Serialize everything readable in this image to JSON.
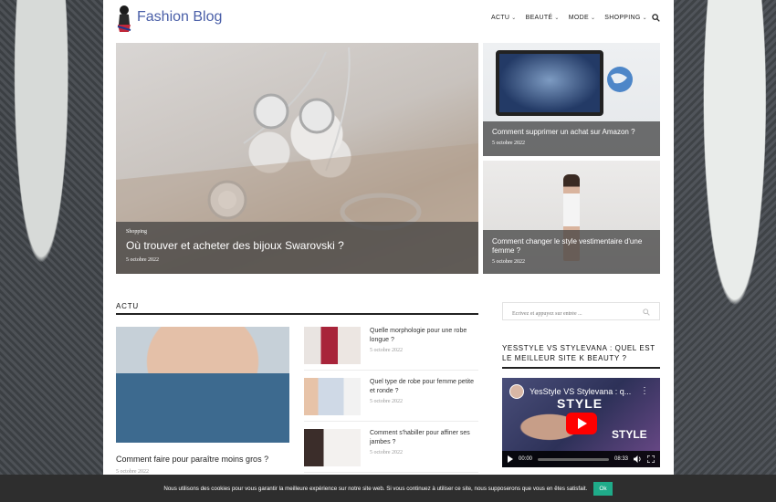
{
  "site": {
    "name": "Fashion Blog"
  },
  "nav": {
    "items": [
      {
        "label": "ACTU"
      },
      {
        "label": "BEAUTÉ"
      },
      {
        "label": "MODE"
      },
      {
        "label": "SHOPPING"
      }
    ]
  },
  "hero": {
    "main": {
      "category": "Shopping",
      "title": "Où trouver et acheter des bijoux Swarovski ?",
      "date": "5 octobre 2022"
    },
    "side1": {
      "title": "Comment supprimer un achat sur Amazon ?",
      "date": "5 octobre 2022"
    },
    "side2": {
      "title": "Comment changer le style vestimentaire d'une femme ?",
      "date": "5 octobre 2022"
    }
  },
  "actu": {
    "heading": "ACTU",
    "featured": {
      "title": "Comment faire pour paraître moins gros ?",
      "date": "5 octobre 2022"
    },
    "list": [
      {
        "title": "Quelle morphologie pour une robe longue ?",
        "date": "5 octobre 2022"
      },
      {
        "title": "Quel type de robe pour femme petite et ronde ?",
        "date": "5 octobre 2022"
      },
      {
        "title": "Comment s'habiller pour affiner ses jambes ?",
        "date": "5 octobre 2022"
      }
    ]
  },
  "sidebar": {
    "search_placeholder": "Ecrivez et appuyez sur entrée ...",
    "heading": "YESSTYLE VS STYLEVANA : QUEL EST LE MEILLEUR SITE K BEAUTY ?",
    "video": {
      "title": "YesStyle VS Stylevana : q...",
      "overlay_text_1": "STYLE",
      "overlay_text_2": "STYLE",
      "time_current": "00:00",
      "time_total": "08:33"
    }
  },
  "cookie": {
    "text": "Nous utilisons des cookies pour vous garantir la meilleure expérience sur notre site web. Si vous continuez à utiliser ce site, nous supposerons que vous en êtes satisfait.",
    "button": "Ok"
  },
  "colors": {
    "logo": "#4a5fa8",
    "cookie_button": "#1fab89",
    "youtube_red": "#ff0000"
  }
}
